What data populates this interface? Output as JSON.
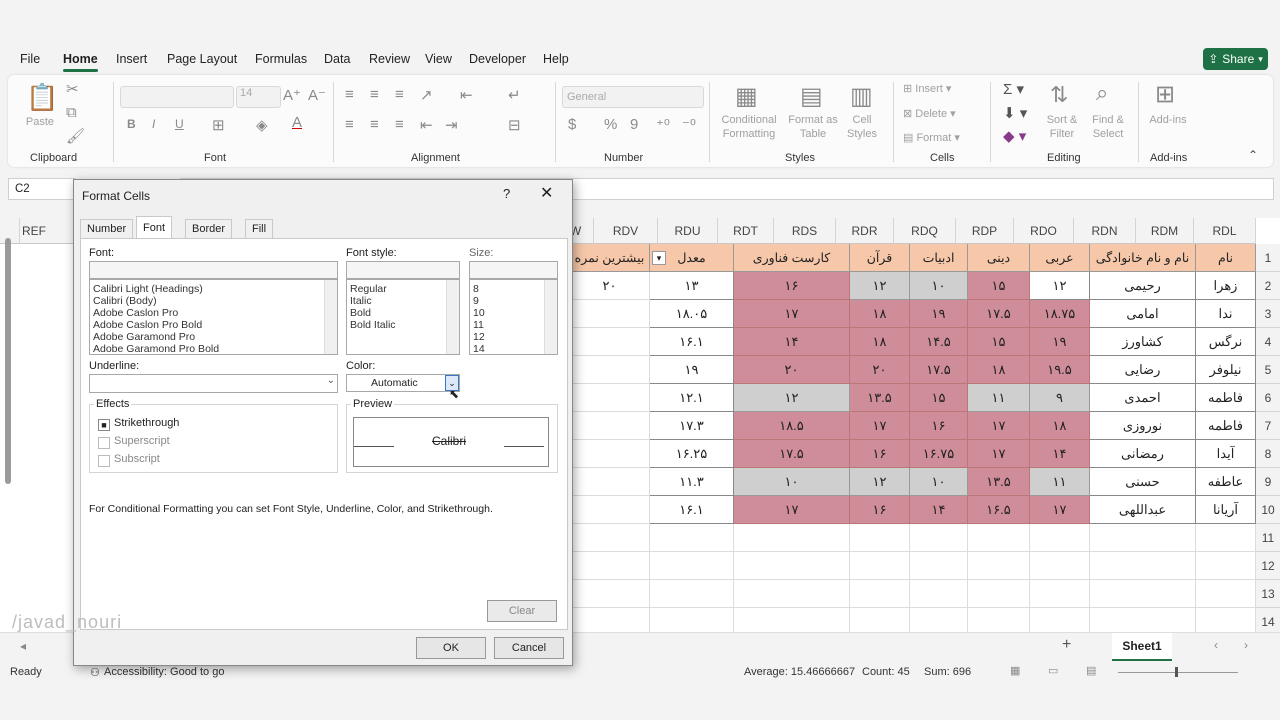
{
  "menu": {
    "items": [
      "File",
      "Home",
      "Insert",
      "Page Layout",
      "Formulas",
      "Data",
      "Review",
      "View",
      "Developer",
      "Help"
    ],
    "active": "Home",
    "share_label": "Share"
  },
  "ribbon": {
    "clipboard": {
      "paste": "Paste",
      "label": "Clipboard"
    },
    "font": {
      "font_size": "14",
      "label": "Font",
      "bold": "B",
      "italic": "I",
      "underline": "U"
    },
    "alignment": {
      "label": "Alignment"
    },
    "number": {
      "format": "General",
      "label": "Number",
      "currency": "$",
      "percent": "%",
      "comma": "9"
    },
    "styles": {
      "conditional": "Conditional Formatting",
      "format_table": "Format as Table",
      "cell_styles": "Cell Styles",
      "label": "Styles"
    },
    "cells": {
      "insert": "Insert",
      "delete": "Delete",
      "format": "Format",
      "label": "Cells"
    },
    "editing": {
      "sort": "Sort & Filter",
      "find": "Find & Select",
      "label": "Editing"
    },
    "addins": {
      "addins": "Add-ins",
      "label": "Add-ins"
    }
  },
  "formula_bar": {
    "name_box": "C2"
  },
  "grid": {
    "left_col_header": "REF",
    "column_headers": [
      "W",
      "RDV",
      "RDU",
      "RDT",
      "RDS",
      "RDR",
      "RDQ",
      "RDP",
      "RDO",
      "RDN",
      "RDM",
      "RDL"
    ],
    "row_numbers": [
      "1",
      "2",
      "3",
      "4",
      "5",
      "6",
      "7",
      "8",
      "9",
      "10",
      "11",
      "12",
      "13",
      "14"
    ],
    "header_row": [
      "بیشترین نمره",
      "معدل",
      "کارست فناوری",
      "قرآن",
      "ادبیات",
      "دینی",
      "عربی",
      "نام و نام خانوادگی",
      "نام"
    ],
    "rows": [
      {
        "max": "۲۰",
        "avg": "۱۳",
        "tech": "۱۶",
        "quran": "۱۲",
        "lit": "۱۰",
        "rel": "۱۵",
        "arabic": "۱۲",
        "family": "رحیمی",
        "name": "زهرا",
        "style": "first"
      },
      {
        "max": "",
        "avg": "۱۸.۰۵",
        "tech": "۱۷",
        "quran": "۱۸",
        "lit": "۱۹",
        "rel": "۱۷.۵",
        "arabic": "۱۸.۷۵",
        "family": "امامی",
        "name": "ندا",
        "style": "pink"
      },
      {
        "max": "",
        "avg": "۱۶.۱",
        "tech": "۱۴",
        "quran": "۱۸",
        "lit": "۱۴.۵",
        "rel": "۱۵",
        "arabic": "۱۹",
        "family": "کشاورز",
        "name": "نرگس",
        "style": "pink"
      },
      {
        "max": "",
        "avg": "۱۹",
        "tech": "۲۰",
        "quran": "۲۰",
        "lit": "۱۷.۵",
        "rel": "۱۸",
        "arabic": "۱۹.۵",
        "family": "رضایی",
        "name": "نیلوفر",
        "style": "pink"
      },
      {
        "max": "",
        "avg": "۱۲.۱",
        "tech": "۱۲",
        "quran": "۱۳.۵",
        "lit": "۱۵",
        "rel": "۱۱",
        "arabic": "۹",
        "family": "احمدی",
        "name": "فاطمه",
        "style": "mixed6"
      },
      {
        "max": "",
        "avg": "۱۷.۳",
        "tech": "۱۸.۵",
        "quran": "۱۷",
        "lit": "۱۶",
        "rel": "۱۷",
        "arabic": "۱۸",
        "family": "نوروزی",
        "name": "فاطمه",
        "style": "pink"
      },
      {
        "max": "",
        "avg": "۱۶.۲۵",
        "tech": "۱۷.۵",
        "quran": "۱۶",
        "lit": "۱۶.۷۵",
        "rel": "۱۷",
        "arabic": "۱۴",
        "family": "رمضانی",
        "name": "آیدا",
        "style": "pink"
      },
      {
        "max": "",
        "avg": "۱۱.۳",
        "tech": "۱۰",
        "quran": "۱۲",
        "lit": "۱۰",
        "rel": "۱۳.۵",
        "arabic": "۱۱",
        "family": "حسنی",
        "name": "عاطفه",
        "style": "mixed9"
      },
      {
        "max": "",
        "avg": "۱۶.۱",
        "tech": "۱۷",
        "quran": "۱۶",
        "lit": "۱۴",
        "rel": "۱۶.۵",
        "arabic": "۱۷",
        "family": "عبداللهی",
        "name": "آریانا",
        "style": "pink"
      }
    ]
  },
  "colors": {
    "pink": "#cf8c99",
    "gray": "#cfcfcf",
    "header": "#f6c7a9",
    "accent": "#1e7145"
  },
  "sheet_tab": "Sheet1",
  "status": {
    "ready": "Ready",
    "accessibility": "Accessibility: Good to go",
    "average": "Average: 15.46666667",
    "count": "Count: 45",
    "sum": "Sum: 696"
  },
  "dialog": {
    "title": "Format Cells",
    "help": "?",
    "tabs": [
      "Number",
      "Font",
      "Border",
      "Fill"
    ],
    "selected_tab": "Font",
    "font_label": "Font:",
    "font_list": [
      "Calibri Light (Headings)",
      "Calibri (Body)",
      "Adobe Caslon Pro",
      "Adobe Caslon Pro Bold",
      "Adobe Garamond Pro",
      "Adobe Garamond Pro Bold"
    ],
    "style_label": "Font style:",
    "style_list": [
      "Regular",
      "Italic",
      "Bold",
      "Bold Italic"
    ],
    "size_label": "Size:",
    "size_list": [
      "8",
      "9",
      "10",
      "11",
      "12",
      "14"
    ],
    "underline_label": "Underline:",
    "color_label": "Color:",
    "color_value": "Automatic",
    "effects_label": "Effects",
    "effects": {
      "strikethrough": "Strikethrough",
      "superscript": "Superscript",
      "subscript": "Subscript"
    },
    "strikethrough_checked": true,
    "preview_label": "Preview",
    "preview_text": "Calibri",
    "note": "For Conditional Formatting you can set Font Style, Underline, Color, and Strikethrough.",
    "clear_label": "Clear",
    "ok_label": "OK",
    "cancel_label": "Cancel"
  },
  "watermark": "/javad_nouri"
}
